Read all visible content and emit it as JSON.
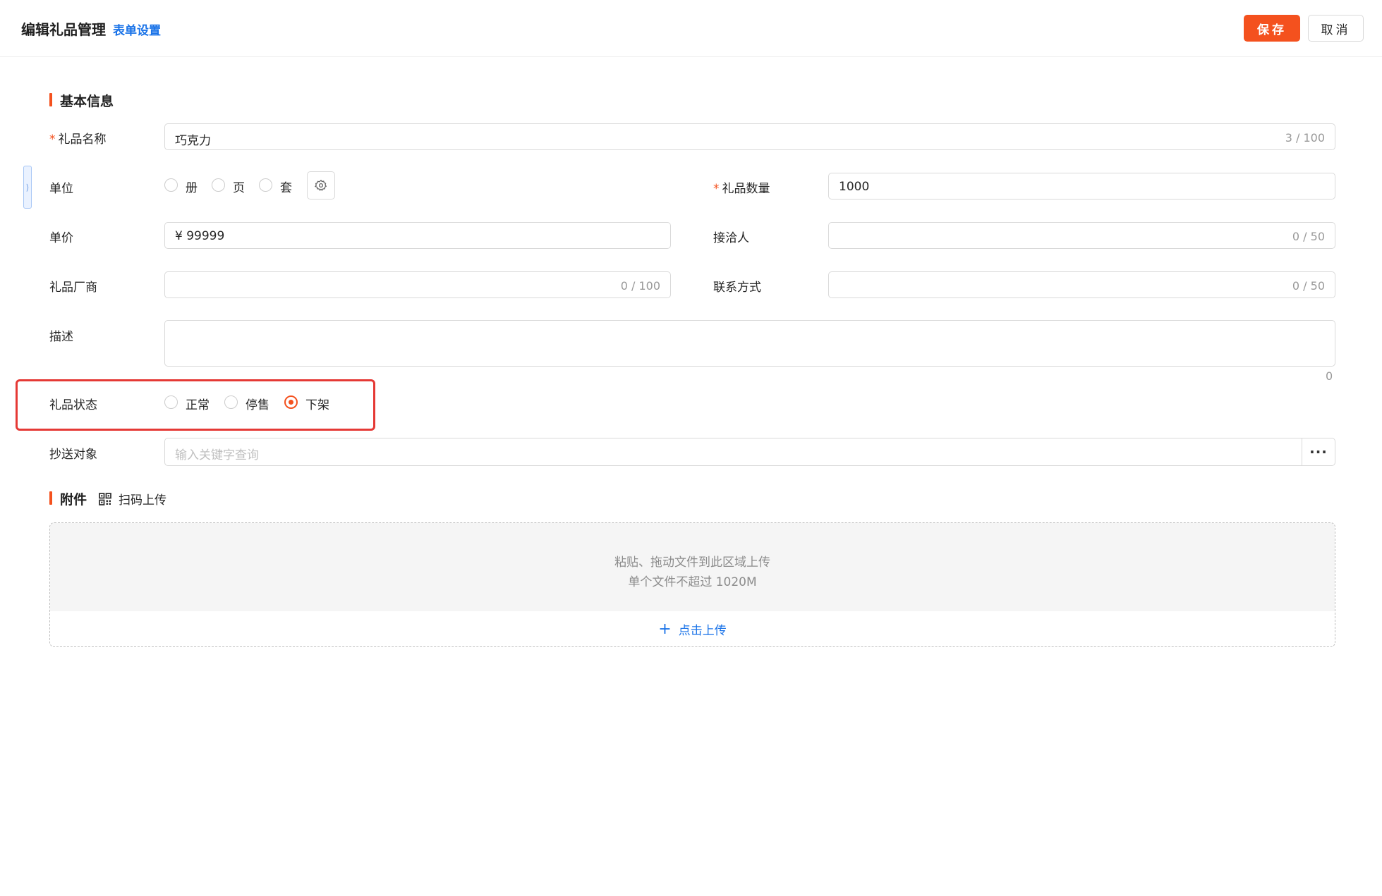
{
  "header": {
    "title": "编辑礼品管理",
    "form_settings": "表单设置",
    "save_label": "保存",
    "cancel_label": "取消"
  },
  "basic_section": {
    "title": "基本信息"
  },
  "fields": {
    "gift_name": {
      "label": "礼品名称",
      "required_mark": "*",
      "value": "巧克力",
      "counter": "3 / 100"
    },
    "unit": {
      "label": "单位",
      "options": [
        "册",
        "页",
        "套"
      ]
    },
    "gift_quantity": {
      "label": "礼品数量",
      "required_mark": "*",
      "value": "1000"
    },
    "unit_price": {
      "label": "单价",
      "value": "¥ 99999"
    },
    "receiver": {
      "label": "接洽人",
      "counter": "0 / 50"
    },
    "vendor": {
      "label": "礼品厂商",
      "counter": "0 / 100"
    },
    "contact": {
      "label": "联系方式",
      "counter": "0 / 50"
    },
    "description": {
      "label": "描述",
      "counter": "0"
    },
    "gift_status": {
      "label": "礼品状态",
      "options": [
        "正常",
        "停售",
        "下架"
      ],
      "selected": "下架"
    },
    "cc_target": {
      "label": "抄送对象",
      "placeholder": "输入关键字查询",
      "more": "···"
    }
  },
  "attachment_section": {
    "title": "附件",
    "scan_upload": "扫码上传",
    "drop_hint": "粘贴、拖动文件到此区域上传",
    "size_hint": "单个文件不超过 1020M",
    "click_upload": "点击上传",
    "plus": "+"
  },
  "colors": {
    "accent": "#f4511e",
    "link": "#1a73e8",
    "highlight_border": "#e53935"
  }
}
